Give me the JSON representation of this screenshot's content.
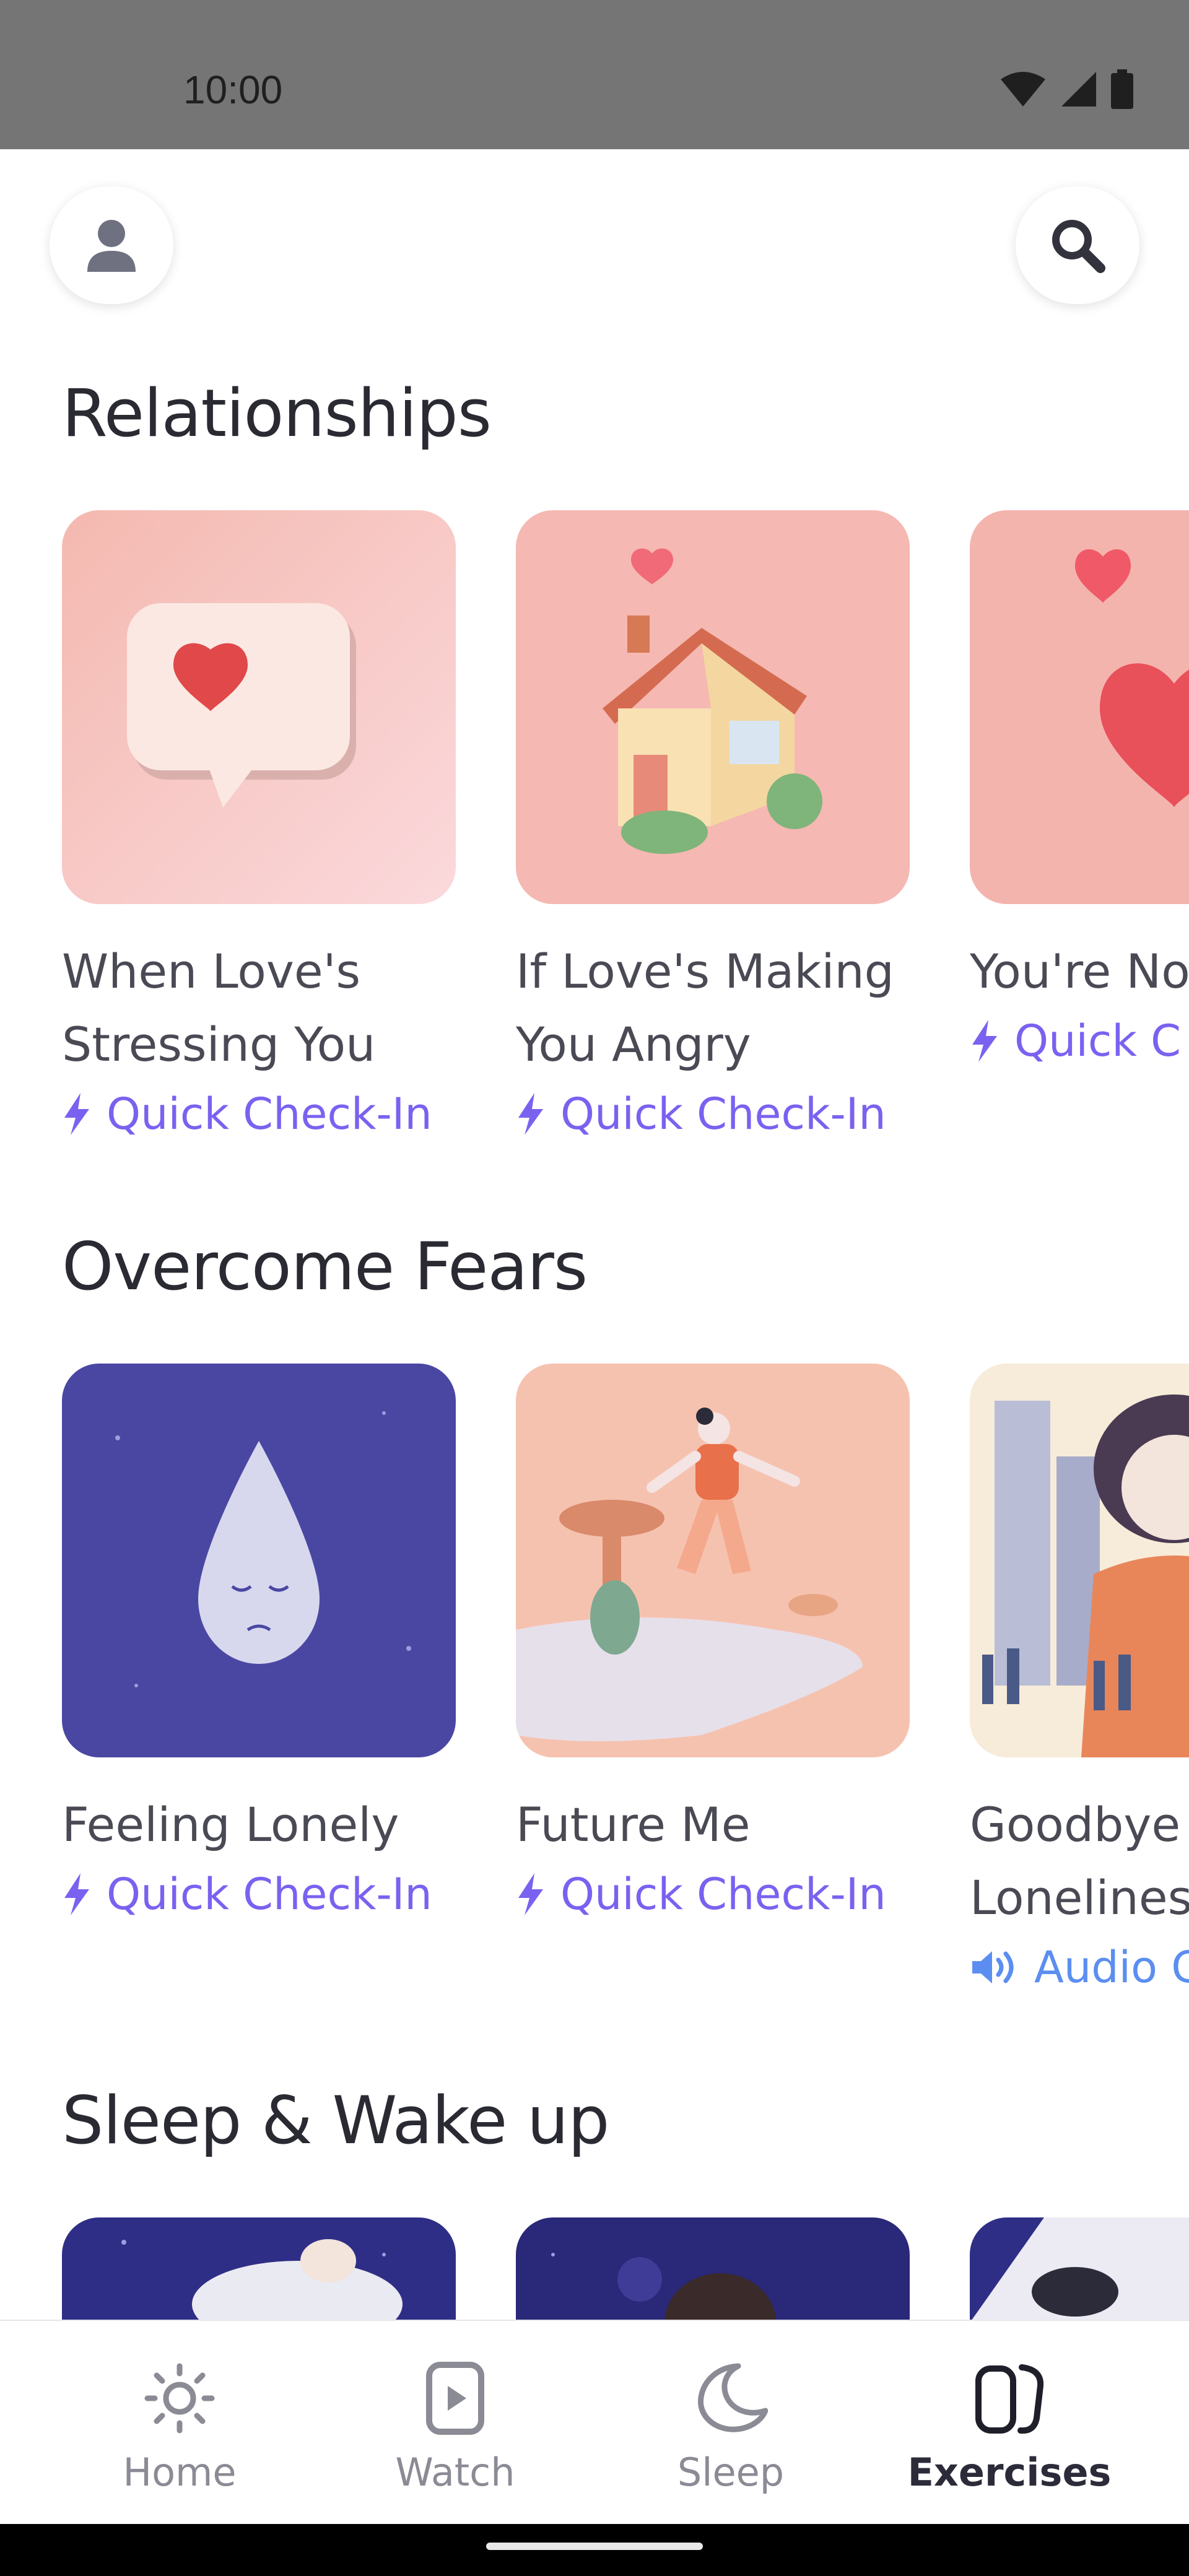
{
  "status_bar": {
    "time": "10:00"
  },
  "header": {
    "profile_icon": "person-icon",
    "search_icon": "search-icon"
  },
  "sections": [
    {
      "title": "Relationships",
      "cards": [
        {
          "title": "When Love's Stressing You",
          "type_label": "Quick Check-In",
          "type_icon": "lightning-icon"
        },
        {
          "title": "If Love's Making You Angry",
          "type_label": "Quick Check-In",
          "type_icon": "lightning-icon"
        },
        {
          "title": "You're No",
          "type_label": "Quick C",
          "type_icon": "lightning-icon"
        }
      ]
    },
    {
      "title": "Overcome Fears",
      "cards": [
        {
          "title": "Feeling Lonely",
          "type_label": "Quick Check-In",
          "type_icon": "lightning-icon"
        },
        {
          "title": "Future Me",
          "type_label": "Quick Check-In",
          "type_icon": "lightning-icon"
        },
        {
          "title": "Goodbye Lonelines",
          "type_label": "Audio G",
          "type_icon": "speaker-icon"
        }
      ]
    },
    {
      "title": "Sleep & Wake up",
      "cards": []
    }
  ],
  "bottom_nav": [
    {
      "label": "Home",
      "icon": "sun-icon",
      "active": false
    },
    {
      "label": "Watch",
      "icon": "play-icon",
      "active": false
    },
    {
      "label": "Sleep",
      "icon": "moon-icon",
      "active": false
    },
    {
      "label": "Exercises",
      "icon": "exercises-icon",
      "active": true
    }
  ],
  "colors": {
    "accent_purple": "#7b61f0",
    "audio_blue": "#5b8ef0",
    "status_bar": "#757575"
  }
}
